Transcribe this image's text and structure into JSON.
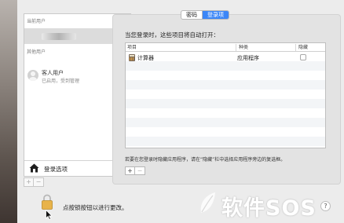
{
  "sidebar": {
    "current_user_title": "当前用户",
    "other_users_title": "其他用户",
    "guest": {
      "name": "客人用户",
      "status": "已启用，受到管理"
    },
    "login_options_label": "登录选项",
    "add_button": "+",
    "remove_button": "−"
  },
  "tabs": [
    {
      "label": "密码",
      "active": false
    },
    {
      "label": "登录项",
      "active": true
    }
  ],
  "login_items": {
    "heading": "当您登录时，这些项目将自动打开：",
    "columns": [
      "项目",
      "种类",
      "隐藏"
    ],
    "rows": [
      {
        "item": "计算器",
        "kind": "应用程序",
        "hide": false,
        "icon": "calculator-icon"
      }
    ],
    "hint": "若要在您登录时隐藏应用程序，请在“隐藏”栏中选择应用程序旁边的复选框。",
    "add_button": "+",
    "remove_button": "−"
  },
  "footer": {
    "lock_text": "点按锁按钮以进行更改。",
    "help_label": "?"
  },
  "watermark": {
    "text": "软件SOS",
    "icon": "leaf-logo-icon"
  },
  "colors": {
    "accent": "#3b86f7",
    "window_bg": "#ececec"
  }
}
